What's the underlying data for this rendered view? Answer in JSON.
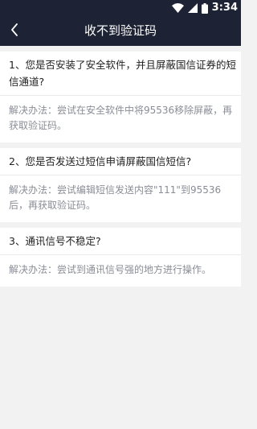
{
  "status_bar": {
    "time": "3:34",
    "icons": [
      "wifi-icon",
      "signal-icon",
      "battery-icon"
    ]
  },
  "header": {
    "back_icon": "chevron-left-icon",
    "title": "收不到验证码"
  },
  "faq": [
    {
      "question": "1、您是否安装了安全软件，并且屏蔽国信证券的短信通道?",
      "answer": "解决办法：尝试在安全软件中将95536移除屏蔽，再获取验证码。"
    },
    {
      "question": "2、您是否发送过短信申请屏蔽国信短信?",
      "answer": "解决办法：尝试编辑短信发送内容\"111\"到95536后，再获取验证码。"
    },
    {
      "question": "3、通讯信号不稳定?",
      "answer": "解决办法：尝试到通讯信号强的地方进行操作。"
    }
  ],
  "colors": {
    "header_bg": "#1d2334",
    "page_bg": "#f2f2f2",
    "question_text": "#222222",
    "answer_text": "#8a8d96"
  }
}
